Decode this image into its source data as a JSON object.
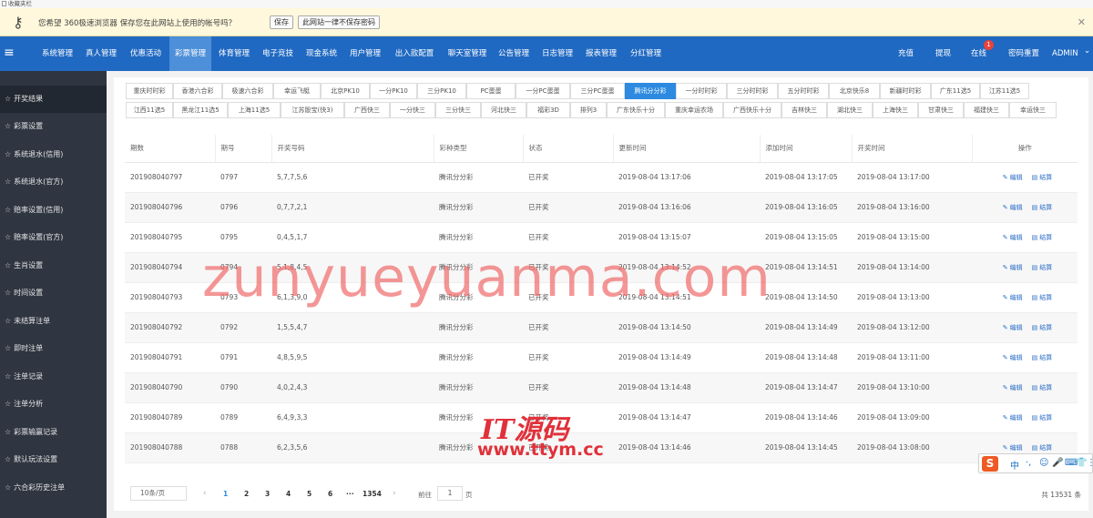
{
  "browser": {
    "favorites_label": "收藏夹栏",
    "password_bar": {
      "message": "您希望 360极速浏览器 保存您在此网站上使用的帐号吗？",
      "save_button": "保存",
      "never_button": "此网站一律不保存密码",
      "close_glyph": "✕"
    }
  },
  "nav": {
    "menu_glyph": "≡",
    "items": [
      "系统管理",
      "真人管理",
      "优惠活动",
      "彩票管理",
      "体育管理",
      "电子竞技",
      "现金系统",
      "用户管理",
      "出入款配置",
      "聊天室管理",
      "公告管理",
      "日志管理",
      "报表管理",
      "分红管理"
    ],
    "active_item": "彩票管理",
    "right": {
      "recharge": "充值",
      "withdraw": "提现",
      "online": "在线",
      "online_badge": "1",
      "password_reset": "密码重置",
      "admin": "ADMIN",
      "admin_caret": "⌄"
    }
  },
  "sidebar": {
    "items": [
      "开奖结果",
      "彩票设置",
      "系统退水(信用)",
      "系统退水(官方)",
      "赔率设置(信用)",
      "赔率设置(官方)",
      "生肖设置",
      "时间设置",
      "未结算注单",
      "即时注单",
      "注单记录",
      "注单分析",
      "彩票输赢记录",
      "默认玩法设置",
      "六合彩历史注单"
    ],
    "active_item": "开奖结果"
  },
  "tabs": {
    "row1": [
      "重庆时时彩",
      "香港六合彩",
      "极速六合彩",
      "幸运飞艇",
      "北京PK10",
      "一分PK10",
      "三分PK10",
      "PC蛋蛋",
      "一分PC蛋蛋",
      "三分PC蛋蛋",
      "腾讯分分彩",
      "一分时时彩",
      "三分时时彩",
      "五分时时彩",
      "北京快乐8",
      "新疆时时彩",
      "广东11选5",
      "江苏11选5"
    ],
    "row2": [
      "江西11选5",
      "黑龙江11选5",
      "上海11选5",
      "江苏骰宝(快3)",
      "广西快三",
      "一分快三",
      "三分快三",
      "河北快三",
      "福彩3D",
      "排列3",
      "广东快乐十分",
      "重庆幸运农场",
      "广西快乐十分",
      "吉林快三",
      "湖北快三",
      "上海快三",
      "甘肃快三",
      "福建快三",
      "幸运快三"
    ],
    "active": "腾讯分分彩"
  },
  "table": {
    "headers": [
      "期数",
      "期号",
      "开奖号码",
      "彩种类型",
      "状态",
      "更新时间",
      "添加时间",
      "开奖时间",
      "操作"
    ],
    "edit_label": "编辑",
    "settle_label": "结算",
    "rows": [
      [
        "201908040797",
        "0797",
        "5,7,7,5,6",
        "腾讯分分彩",
        "已开奖",
        "2019-08-04 13:17:06",
        "2019-08-04 13:17:05",
        "2019-08-04 13:17:00"
      ],
      [
        "201908040796",
        "0796",
        "0,7,7,2,1",
        "腾讯分分彩",
        "已开奖",
        "2019-08-04 13:16:06",
        "2019-08-04 13:16:05",
        "2019-08-04 13:16:00"
      ],
      [
        "201908040795",
        "0795",
        "0,4,5,1,7",
        "腾讯分分彩",
        "已开奖",
        "2019-08-04 13:15:07",
        "2019-08-04 13:15:05",
        "2019-08-04 13:15:00"
      ],
      [
        "201908040794",
        "0794",
        "5,1,8,4,5",
        "腾讯分分彩",
        "已开奖",
        "2019-08-04 13:14:52",
        "2019-08-04 13:14:51",
        "2019-08-04 13:14:00"
      ],
      [
        "201908040793",
        "0793",
        "6,1,3,9,0",
        "腾讯分分彩",
        "已开奖",
        "2019-08-04 13:14:51",
        "2019-08-04 13:14:50",
        "2019-08-04 13:13:00"
      ],
      [
        "201908040792",
        "0792",
        "1,5,5,4,7",
        "腾讯分分彩",
        "已开奖",
        "2019-08-04 13:14:50",
        "2019-08-04 13:14:49",
        "2019-08-04 13:12:00"
      ],
      [
        "201908040791",
        "0791",
        "4,8,5,9,5",
        "腾讯分分彩",
        "已开奖",
        "2019-08-04 13:14:49",
        "2019-08-04 13:14:48",
        "2019-08-04 13:11:00"
      ],
      [
        "201908040790",
        "0790",
        "4,0,2,4,3",
        "腾讯分分彩",
        "已开奖",
        "2019-08-04 13:14:48",
        "2019-08-04 13:14:47",
        "2019-08-04 13:10:00"
      ],
      [
        "201908040789",
        "0789",
        "6,4,9,3,3",
        "腾讯分分彩",
        "已开奖",
        "2019-08-04 13:14:47",
        "2019-08-04 13:14:46",
        "2019-08-04 13:09:00"
      ],
      [
        "201908040788",
        "0788",
        "6,2,3,5,6",
        "腾讯分分彩",
        "已开奖",
        "2019-08-04 13:14:46",
        "2019-08-04 13:14:45",
        "2019-08-04 13:08:00"
      ]
    ]
  },
  "pager": {
    "page_size": "10条/页",
    "pages": [
      "1",
      "2",
      "3",
      "4",
      "5",
      "6",
      "···",
      "1354"
    ],
    "current": "1",
    "goto_label": "前往",
    "goto_value": "1",
    "page_unit": "页",
    "total": "共 13531 条",
    "prev_glyph": "‹",
    "next_glyph": "›"
  },
  "overlays": {
    "watermark": "zunyueyuanma.com",
    "logo_line1": "IT源码",
    "logo_line2": "www.ttym.cc",
    "ime_glyphs": [
      "中",
      "·,",
      "☺",
      "🎤",
      "⌨",
      "👕",
      "⋮"
    ]
  }
}
